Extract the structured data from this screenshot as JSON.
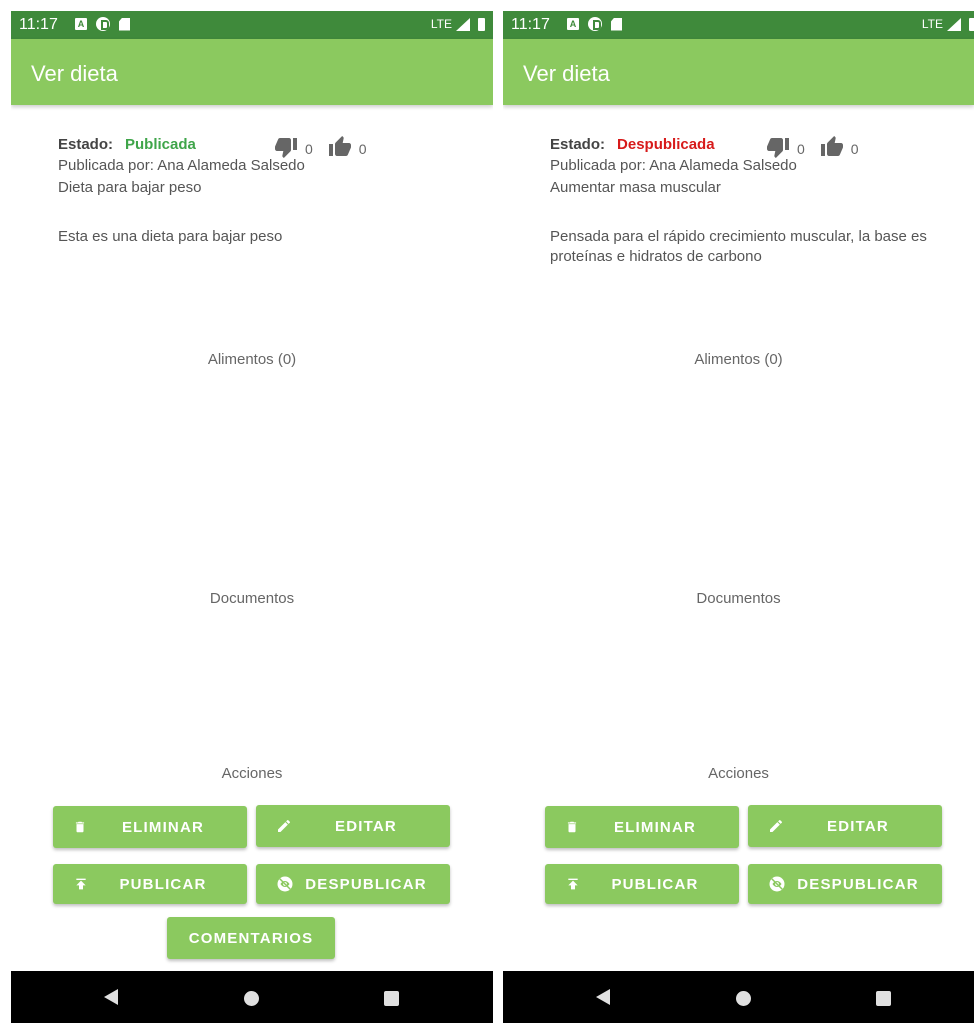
{
  "colors": {
    "status_bar": "#3f8a3b",
    "app_bar": "#8bc95f",
    "published": "#3fa54a",
    "unpublished": "#d71a1a",
    "nav_bar": "#000000"
  },
  "screens": [
    {
      "statusbar": {
        "time": "11:17",
        "network": "LTE"
      },
      "appbar": {
        "title": "Ver dieta"
      },
      "estado_label": "Estado:",
      "estado_value": "Publicada",
      "estado_color": "#3fa54a",
      "dislikes": "0",
      "likes": "0",
      "published_by": "Publicada por: Ana Alameda Salsedo",
      "diet_name": "Dieta para bajar peso",
      "description": "Esta es una dieta para bajar peso",
      "alimentos_title": "Alimentos (0)",
      "documentos_title": "Documentos",
      "acciones_title": "Acciones",
      "buttons": {
        "eliminar": "ELIMINAR",
        "editar": "EDITAR",
        "publicar": "PUBLICAR",
        "despublicar": "DESPUBLICAR",
        "comentarios": "COMENTARIOS"
      }
    },
    {
      "statusbar": {
        "time": "11:17",
        "network": "LTE"
      },
      "appbar": {
        "title": "Ver dieta"
      },
      "estado_label": "Estado:",
      "estado_value": "Despublicada",
      "estado_color": "#d71a1a",
      "dislikes": "0",
      "likes": "0",
      "published_by": "Publicada por: Ana Alameda Salsedo",
      "diet_name": "Aumentar masa muscular",
      "description": "Pensada para el rápido crecimiento muscular, la base es proteínas e hidratos de carbono",
      "alimentos_title": "Alimentos (0)",
      "documentos_title": "Documentos",
      "acciones_title": "Acciones",
      "buttons": {
        "eliminar": "ELIMINAR",
        "editar": "EDITAR",
        "publicar": "PUBLICAR",
        "despublicar": "DESPUBLICAR"
      }
    }
  ],
  "icons": [
    "thumb-down-icon",
    "thumb-up-icon",
    "trash-icon",
    "pencil-icon",
    "publish-icon",
    "visibility-off-icon",
    "back-icon",
    "home-icon",
    "recents-icon"
  ]
}
